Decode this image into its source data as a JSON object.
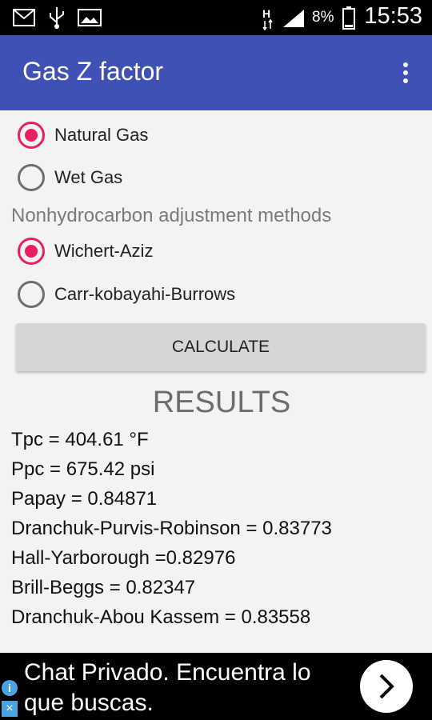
{
  "status_bar": {
    "time": "15:53",
    "battery_percent": "8%"
  },
  "app_bar": {
    "title": "Gas Z factor",
    "menu_icon": "more-vert-icon"
  },
  "gas_type": {
    "options": [
      {
        "label": "Natural Gas",
        "checked": true
      },
      {
        "label": "Wet Gas",
        "checked": false
      }
    ]
  },
  "nonhydrocarbon": {
    "title": "Nonhydrocarbon adjustment methods",
    "options": [
      {
        "label": "Wichert-Aziz",
        "checked": true
      },
      {
        "label": "Carr-kobayahi-Burrows",
        "checked": false
      }
    ]
  },
  "calculate_label": "CALCULATE",
  "results": {
    "title": "RESULTS",
    "lines": [
      "Tpc = 404.61 °F",
      "Ppc = 675.42 psi",
      "Papay = 0.84871",
      "Dranchuk-Purvis-Robinson = 0.83773",
      "Hall-Yarborough =0.82976",
      "Brill-Beggs = 0.82347",
      "Dranchuk-Abou Kassem = 0.83558"
    ]
  },
  "ad": {
    "text": "Chat Privado. Encuentra lo que buscas.",
    "accent": "#4aa3df"
  },
  "colors": {
    "primary": "#3f51b5",
    "accent": "#e91e63"
  }
}
